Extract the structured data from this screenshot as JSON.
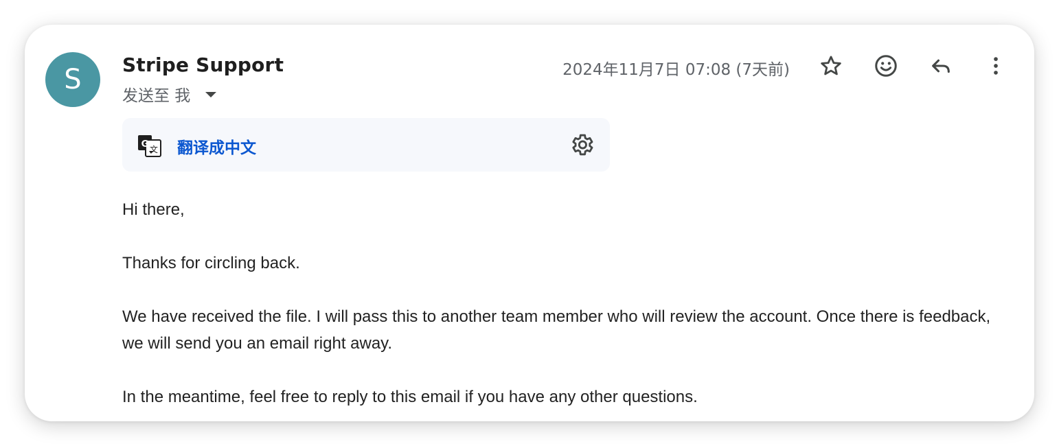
{
  "colors": {
    "avatar_bg": "#4a97a3",
    "link_blue": "#0b57d0",
    "icon_gray": "#444746"
  },
  "sender": {
    "avatar_letter": "S",
    "name": "Stripe Support",
    "recipient_label": "发送至 我"
  },
  "header": {
    "date": "2024年11月7日 07:08 (7天前)",
    "icons": [
      "star-icon",
      "emoji-icon",
      "reply-icon",
      "more-vert-icon"
    ]
  },
  "translate": {
    "icon": "translate-icon",
    "label": "翻译成中文",
    "settings_icon": "gear-icon"
  },
  "message": {
    "paragraphs": [
      "Hi there,",
      "Thanks for circling back.",
      "We have received the file. I will pass this to another team member who will review the account. Once there is feedback, we will send you an email right away.",
      "In the meantime, feel free to reply to this email if you have any other questions."
    ]
  }
}
